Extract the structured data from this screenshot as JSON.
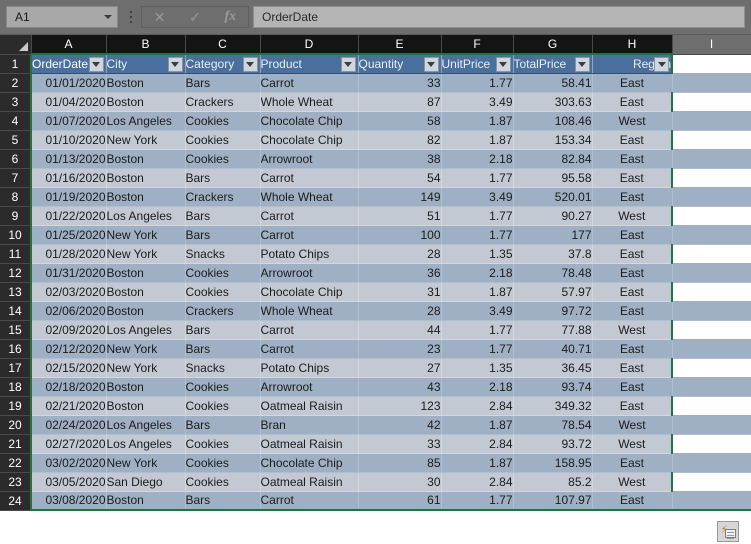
{
  "app": {
    "name_box_value": "A1",
    "formula_value": "OrderDate",
    "cancel_icon": "close-icon",
    "enter_icon": "check-icon",
    "function_icon": "fx-icon",
    "quick_analysis_icon": "quick-analysis-icon",
    "accent_color": "#217346",
    "header_fill": "#4a6f9c",
    "band_fill": "#9fb0c4",
    "row_fill": "#c3c9d2"
  },
  "grid": {
    "column_headers": [
      "A",
      "B",
      "C",
      "D",
      "E",
      "F",
      "G",
      "H",
      "I"
    ],
    "active_column_count": 8,
    "row_numbers": [
      1,
      2,
      3,
      4,
      5,
      6,
      7,
      8,
      9,
      10,
      11,
      12,
      13,
      14,
      15,
      16,
      17,
      18,
      19,
      20,
      21,
      22,
      23,
      24
    ],
    "headers": [
      "OrderDate",
      "City",
      "Category",
      "Product",
      "Quantity",
      "UnitPrice",
      "TotalPrice",
      "Region"
    ],
    "rows": [
      [
        "01/01/2020",
        "Boston",
        "Bars",
        "Carrot",
        "33",
        "1.77",
        "58.41",
        "East"
      ],
      [
        "01/04/2020",
        "Boston",
        "Crackers",
        "Whole Wheat",
        "87",
        "3.49",
        "303.63",
        "East"
      ],
      [
        "01/07/2020",
        "Los Angeles",
        "Cookies",
        "Chocolate Chip",
        "58",
        "1.87",
        "108.46",
        "West"
      ],
      [
        "01/10/2020",
        "New York",
        "Cookies",
        "Chocolate Chip",
        "82",
        "1.87",
        "153.34",
        "East"
      ],
      [
        "01/13/2020",
        "Boston",
        "Cookies",
        "Arrowroot",
        "38",
        "2.18",
        "82.84",
        "East"
      ],
      [
        "01/16/2020",
        "Boston",
        "Bars",
        "Carrot",
        "54",
        "1.77",
        "95.58",
        "East"
      ],
      [
        "01/19/2020",
        "Boston",
        "Crackers",
        "Whole Wheat",
        "149",
        "3.49",
        "520.01",
        "East"
      ],
      [
        "01/22/2020",
        "Los Angeles",
        "Bars",
        "Carrot",
        "51",
        "1.77",
        "90.27",
        "West"
      ],
      [
        "01/25/2020",
        "New York",
        "Bars",
        "Carrot",
        "100",
        "1.77",
        "177",
        "East"
      ],
      [
        "01/28/2020",
        "New York",
        "Snacks",
        "Potato Chips",
        "28",
        "1.35",
        "37.8",
        "East"
      ],
      [
        "01/31/2020",
        "Boston",
        "Cookies",
        "Arrowroot",
        "36",
        "2.18",
        "78.48",
        "East"
      ],
      [
        "02/03/2020",
        "Boston",
        "Cookies",
        "Chocolate Chip",
        "31",
        "1.87",
        "57.97",
        "East"
      ],
      [
        "02/06/2020",
        "Boston",
        "Crackers",
        "Whole Wheat",
        "28",
        "3.49",
        "97.72",
        "East"
      ],
      [
        "02/09/2020",
        "Los Angeles",
        "Bars",
        "Carrot",
        "44",
        "1.77",
        "77.88",
        "West"
      ],
      [
        "02/12/2020",
        "New York",
        "Bars",
        "Carrot",
        "23",
        "1.77",
        "40.71",
        "East"
      ],
      [
        "02/15/2020",
        "New York",
        "Snacks",
        "Potato Chips",
        "27",
        "1.35",
        "36.45",
        "East"
      ],
      [
        "02/18/2020",
        "Boston",
        "Cookies",
        "Arrowroot",
        "43",
        "2.18",
        "93.74",
        "East"
      ],
      [
        "02/21/2020",
        "Boston",
        "Cookies",
        "Oatmeal Raisin",
        "123",
        "2.84",
        "349.32",
        "East"
      ],
      [
        "02/24/2020",
        "Los Angeles",
        "Bars",
        "Bran",
        "42",
        "1.87",
        "78.54",
        "West"
      ],
      [
        "02/27/2020",
        "Los Angeles",
        "Cookies",
        "Oatmeal Raisin",
        "33",
        "2.84",
        "93.72",
        "West"
      ],
      [
        "03/02/2020",
        "New York",
        "Cookies",
        "Chocolate Chip",
        "85",
        "1.87",
        "158.95",
        "East"
      ],
      [
        "03/05/2020",
        "San Diego",
        "Cookies",
        "Oatmeal Raisin",
        "30",
        "2.84",
        "85.2",
        "West"
      ],
      [
        "03/08/2020",
        "Boston",
        "Bars",
        "Carrot",
        "61",
        "1.77",
        "107.97",
        "East"
      ]
    ]
  }
}
